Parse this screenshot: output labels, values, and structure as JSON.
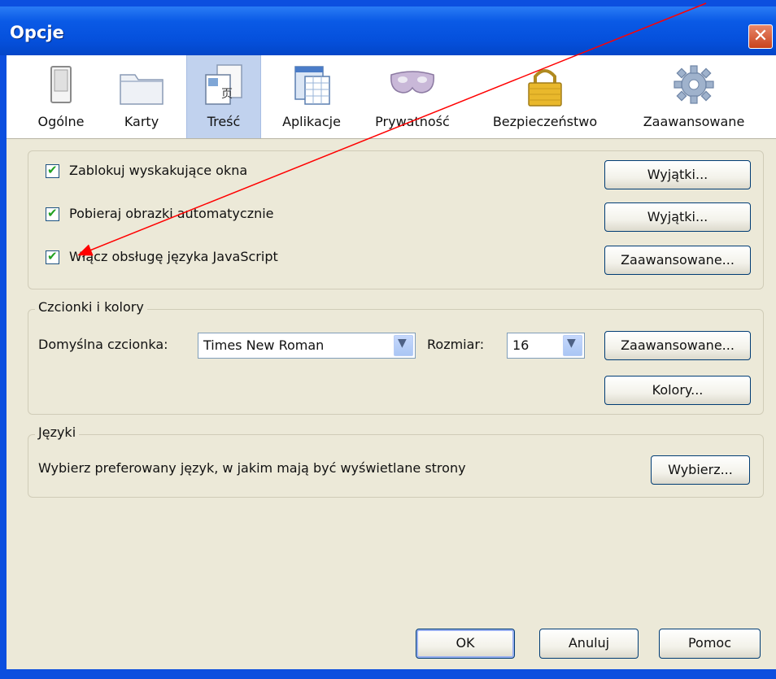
{
  "window": {
    "title": "Opcje",
    "close_glyph": "✕"
  },
  "tabs": [
    {
      "label": "Ogólne",
      "icon": "switch-icon"
    },
    {
      "label": "Karty",
      "icon": "folder-tabs-icon"
    },
    {
      "label": "Treść",
      "icon": "content-page-icon"
    },
    {
      "label": "Aplikacje",
      "icon": "applications-icon"
    },
    {
      "label": "Prywatność",
      "icon": "mask-icon"
    },
    {
      "label": "Bezpieczeństwo",
      "icon": "padlock-icon"
    },
    {
      "label": "Zaawansowane",
      "icon": "gear-icon"
    }
  ],
  "selected_tab": "Treść",
  "general": {
    "options": [
      {
        "label": "Zablokuj wyskakujące okna",
        "checked": true,
        "button": "Wyjątki..."
      },
      {
        "label": "Pobieraj obrazki automatycznie",
        "checked": true,
        "button": "Wyjątki..."
      },
      {
        "label": "Włącz obsługę języka JavaScript",
        "checked": true,
        "button": "Zaawansowane..."
      }
    ],
    "check_glyph": "✔"
  },
  "fonts": {
    "legend": "Czcionki i kolory",
    "default_font_label": "Domyślna czcionka:",
    "default_font_value": "Times New Roman",
    "size_label": "Rozmiar:",
    "size_value": "16",
    "advanced_button": "Zaawansowane...",
    "colors_button": "Kolory...",
    "dropdown_glyph": "▼"
  },
  "languages": {
    "legend": "Języki",
    "description": "Wybierz preferowany język, w jakim mają być wyświetlane strony",
    "choose_button": "Wybierz..."
  },
  "footer": {
    "ok": "OK",
    "cancel": "Anuluj",
    "help": "Pomoc"
  },
  "colors": {
    "titlebar": "#0550dc",
    "dialog_bg": "#ece9d8",
    "selected_tab": "#c1d2ee",
    "annotation_arrow": "#ff0000"
  }
}
